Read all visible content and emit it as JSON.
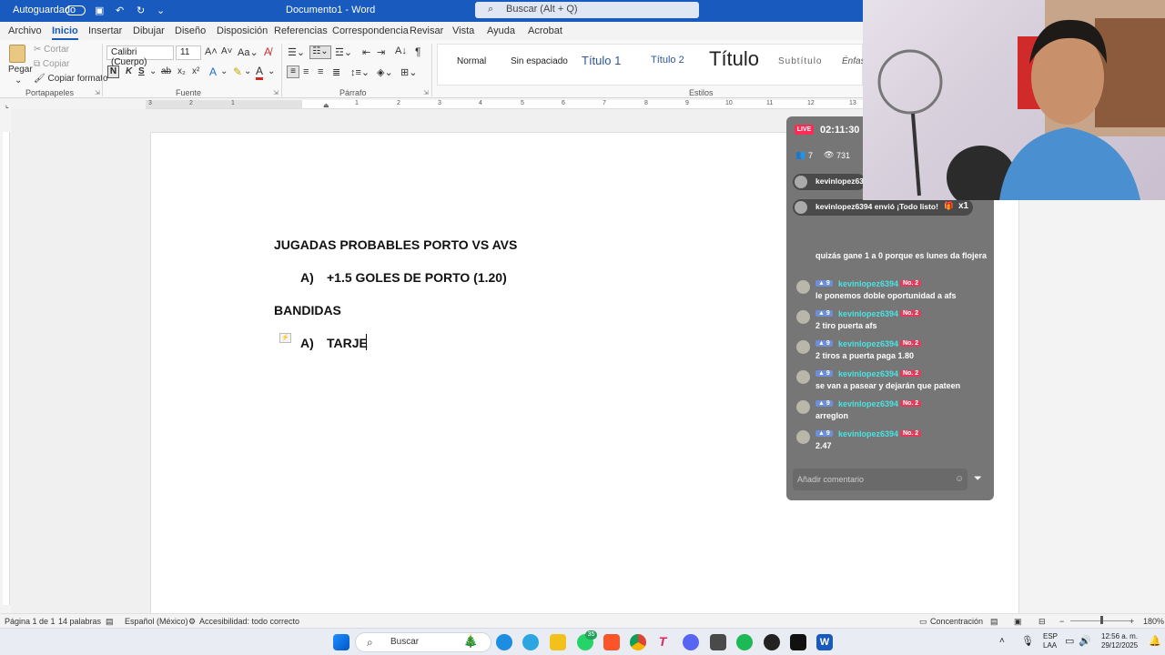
{
  "titlebar": {
    "autosave": "Autoguardado",
    "doc_title": "Documento1 - Word",
    "search_placeholder": "Buscar (Alt + Q)"
  },
  "menu": {
    "tabs": [
      "Archivo",
      "Inicio",
      "Insertar",
      "Dibujar",
      "Diseño",
      "Disposición",
      "Referencias",
      "Correspondencia",
      "Revisar",
      "Vista",
      "Ayuda",
      "Acrobat"
    ],
    "active_tab": "Inicio"
  },
  "ribbon": {
    "clipboard": {
      "paste": "Pegar",
      "cut": "Cortar",
      "copy": "Copiar",
      "format_painter": "Copiar formato",
      "group": "Portapapeles"
    },
    "font": {
      "name": "Calibri (Cuerpo)",
      "size": "11",
      "group": "Fuente",
      "bold": "N",
      "italic": "K",
      "underline": "S"
    },
    "paragraph": {
      "group": "Párrafo"
    },
    "styles": {
      "group": "Estilos",
      "items": [
        "Normal",
        "Sin espaciado",
        "Título 1",
        "Título 2",
        "Título",
        "Subtítulo",
        "Énfas"
      ]
    }
  },
  "ruler": {
    "ticks": [
      "3",
      "2",
      "1",
      "1",
      "2",
      "3",
      "4",
      "5",
      "6",
      "7",
      "8",
      "9",
      "10",
      "11",
      "12",
      "13",
      "14"
    ]
  },
  "document": {
    "line1": "JUGADAS PROBABLES PORTO VS AVS",
    "line2_marker": "A)",
    "line2": "+1.5 GOLES DE PORTO (1.20)",
    "line3": "BANDIDAS",
    "line4_marker": "A)",
    "line4": "TARJE"
  },
  "status": {
    "page": "Página 1 de 1",
    "words": "14 palabras",
    "language": "Español (México)",
    "accessibility": "Accesibilidad: todo correcto",
    "focus": "Concentración",
    "zoom": "180%"
  },
  "taskbar": {
    "search_placeholder": "Buscar",
    "lang1": "ESP",
    "lang2": "LAA",
    "time": "12:56 a. m.",
    "date": "29/12/2025",
    "whatsapp_badge": "35"
  },
  "live": {
    "badge": "LIVE",
    "timer": "02:11:30",
    "members": "7",
    "viewers": "731",
    "pinned_user": "kevinlopez63",
    "gift_text": "kevinlopez6394 envió ¡Todo listo!",
    "gift_count": "x1",
    "top_comment": "quizás gane 1 a 0 porque es lunes da flojera",
    "comments": [
      {
        "level": "9",
        "user": "kevinlopez6394",
        "rank": "No. 2",
        "msg": "le ponemos doble oportunidad a afs"
      },
      {
        "level": "9",
        "user": "kevinlopez6394",
        "rank": "No. 2",
        "msg": "2 tiro puerta afs"
      },
      {
        "level": "9",
        "user": "kevinlopez6394",
        "rank": "No. 2",
        "msg": "2 tiros a puerta paga 1.80"
      },
      {
        "level": "9",
        "user": "kevinlopez6394",
        "rank": "No. 2",
        "msg": "se van a pasear y dejarán que pateen"
      },
      {
        "level": "9",
        "user": "kevinlopez6394",
        "rank": "No. 2",
        "msg": "arreglon"
      },
      {
        "level": "9",
        "user": "kevinlopez6394",
        "rank": "No. 2",
        "msg": "2.47"
      }
    ],
    "comment_placeholder": "Añadir comentario"
  },
  "colors": {
    "word_blue": "#185abd",
    "live_red": "#fe2c55",
    "username_cyan": "#49e3e3"
  }
}
